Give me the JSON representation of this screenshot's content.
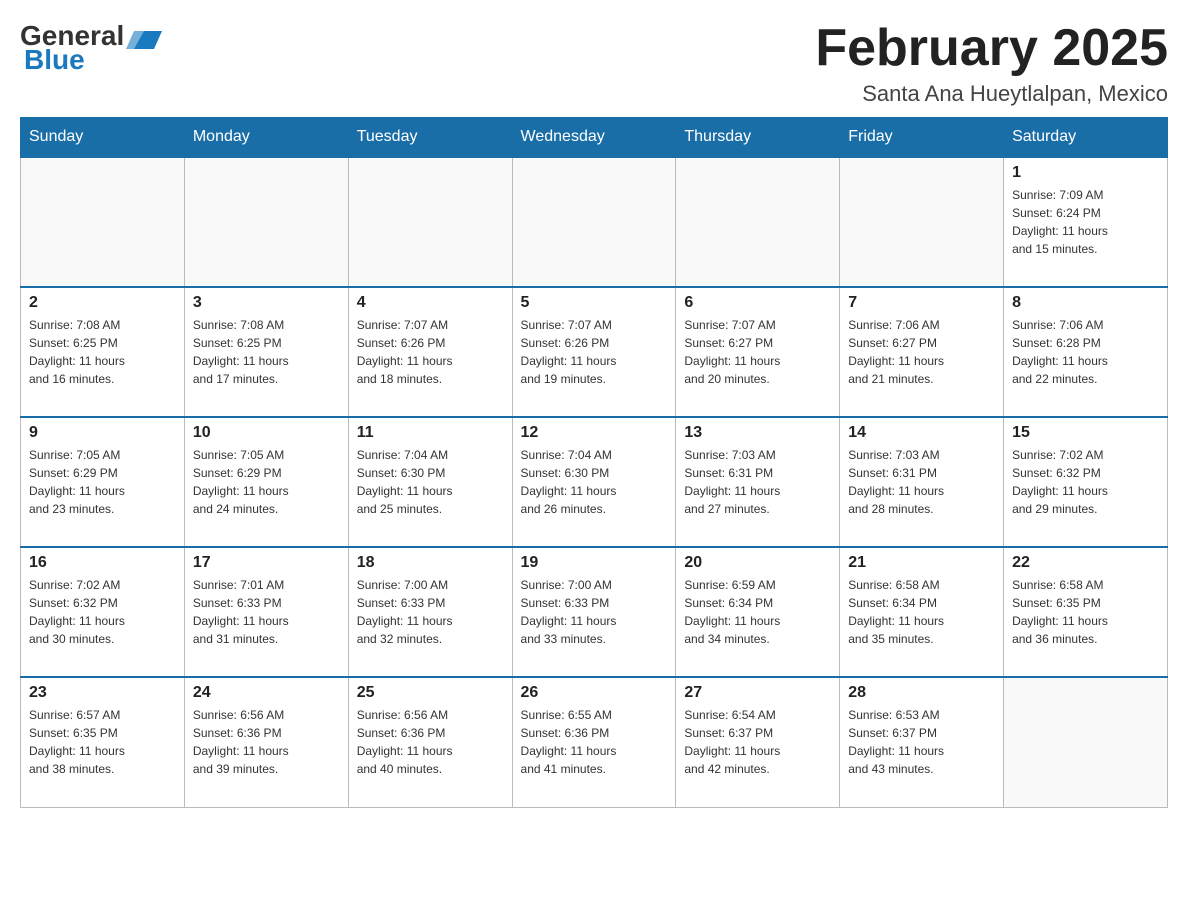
{
  "header": {
    "logo_general": "General",
    "logo_blue": "Blue",
    "month_title": "February 2025",
    "location": "Santa Ana Hueytlalpan, Mexico"
  },
  "days_of_week": [
    "Sunday",
    "Monday",
    "Tuesday",
    "Wednesday",
    "Thursday",
    "Friday",
    "Saturday"
  ],
  "weeks": [
    {
      "days": [
        {
          "number": "",
          "info": "",
          "empty": true
        },
        {
          "number": "",
          "info": "",
          "empty": true
        },
        {
          "number": "",
          "info": "",
          "empty": true
        },
        {
          "number": "",
          "info": "",
          "empty": true
        },
        {
          "number": "",
          "info": "",
          "empty": true
        },
        {
          "number": "",
          "info": "",
          "empty": true
        },
        {
          "number": "1",
          "info": "Sunrise: 7:09 AM\nSunset: 6:24 PM\nDaylight: 11 hours\nand 15 minutes.",
          "empty": false
        }
      ]
    },
    {
      "days": [
        {
          "number": "2",
          "info": "Sunrise: 7:08 AM\nSunset: 6:25 PM\nDaylight: 11 hours\nand 16 minutes.",
          "empty": false
        },
        {
          "number": "3",
          "info": "Sunrise: 7:08 AM\nSunset: 6:25 PM\nDaylight: 11 hours\nand 17 minutes.",
          "empty": false
        },
        {
          "number": "4",
          "info": "Sunrise: 7:07 AM\nSunset: 6:26 PM\nDaylight: 11 hours\nand 18 minutes.",
          "empty": false
        },
        {
          "number": "5",
          "info": "Sunrise: 7:07 AM\nSunset: 6:26 PM\nDaylight: 11 hours\nand 19 minutes.",
          "empty": false
        },
        {
          "number": "6",
          "info": "Sunrise: 7:07 AM\nSunset: 6:27 PM\nDaylight: 11 hours\nand 20 minutes.",
          "empty": false
        },
        {
          "number": "7",
          "info": "Sunrise: 7:06 AM\nSunset: 6:27 PM\nDaylight: 11 hours\nand 21 minutes.",
          "empty": false
        },
        {
          "number": "8",
          "info": "Sunrise: 7:06 AM\nSunset: 6:28 PM\nDaylight: 11 hours\nand 22 minutes.",
          "empty": false
        }
      ]
    },
    {
      "days": [
        {
          "number": "9",
          "info": "Sunrise: 7:05 AM\nSunset: 6:29 PM\nDaylight: 11 hours\nand 23 minutes.",
          "empty": false
        },
        {
          "number": "10",
          "info": "Sunrise: 7:05 AM\nSunset: 6:29 PM\nDaylight: 11 hours\nand 24 minutes.",
          "empty": false
        },
        {
          "number": "11",
          "info": "Sunrise: 7:04 AM\nSunset: 6:30 PM\nDaylight: 11 hours\nand 25 minutes.",
          "empty": false
        },
        {
          "number": "12",
          "info": "Sunrise: 7:04 AM\nSunset: 6:30 PM\nDaylight: 11 hours\nand 26 minutes.",
          "empty": false
        },
        {
          "number": "13",
          "info": "Sunrise: 7:03 AM\nSunset: 6:31 PM\nDaylight: 11 hours\nand 27 minutes.",
          "empty": false
        },
        {
          "number": "14",
          "info": "Sunrise: 7:03 AM\nSunset: 6:31 PM\nDaylight: 11 hours\nand 28 minutes.",
          "empty": false
        },
        {
          "number": "15",
          "info": "Sunrise: 7:02 AM\nSunset: 6:32 PM\nDaylight: 11 hours\nand 29 minutes.",
          "empty": false
        }
      ]
    },
    {
      "days": [
        {
          "number": "16",
          "info": "Sunrise: 7:02 AM\nSunset: 6:32 PM\nDaylight: 11 hours\nand 30 minutes.",
          "empty": false
        },
        {
          "number": "17",
          "info": "Sunrise: 7:01 AM\nSunset: 6:33 PM\nDaylight: 11 hours\nand 31 minutes.",
          "empty": false
        },
        {
          "number": "18",
          "info": "Sunrise: 7:00 AM\nSunset: 6:33 PM\nDaylight: 11 hours\nand 32 minutes.",
          "empty": false
        },
        {
          "number": "19",
          "info": "Sunrise: 7:00 AM\nSunset: 6:33 PM\nDaylight: 11 hours\nand 33 minutes.",
          "empty": false
        },
        {
          "number": "20",
          "info": "Sunrise: 6:59 AM\nSunset: 6:34 PM\nDaylight: 11 hours\nand 34 minutes.",
          "empty": false
        },
        {
          "number": "21",
          "info": "Sunrise: 6:58 AM\nSunset: 6:34 PM\nDaylight: 11 hours\nand 35 minutes.",
          "empty": false
        },
        {
          "number": "22",
          "info": "Sunrise: 6:58 AM\nSunset: 6:35 PM\nDaylight: 11 hours\nand 36 minutes.",
          "empty": false
        }
      ]
    },
    {
      "days": [
        {
          "number": "23",
          "info": "Sunrise: 6:57 AM\nSunset: 6:35 PM\nDaylight: 11 hours\nand 38 minutes.",
          "empty": false
        },
        {
          "number": "24",
          "info": "Sunrise: 6:56 AM\nSunset: 6:36 PM\nDaylight: 11 hours\nand 39 minutes.",
          "empty": false
        },
        {
          "number": "25",
          "info": "Sunrise: 6:56 AM\nSunset: 6:36 PM\nDaylight: 11 hours\nand 40 minutes.",
          "empty": false
        },
        {
          "number": "26",
          "info": "Sunrise: 6:55 AM\nSunset: 6:36 PM\nDaylight: 11 hours\nand 41 minutes.",
          "empty": false
        },
        {
          "number": "27",
          "info": "Sunrise: 6:54 AM\nSunset: 6:37 PM\nDaylight: 11 hours\nand 42 minutes.",
          "empty": false
        },
        {
          "number": "28",
          "info": "Sunrise: 6:53 AM\nSunset: 6:37 PM\nDaylight: 11 hours\nand 43 minutes.",
          "empty": false
        },
        {
          "number": "",
          "info": "",
          "empty": true
        }
      ]
    }
  ]
}
